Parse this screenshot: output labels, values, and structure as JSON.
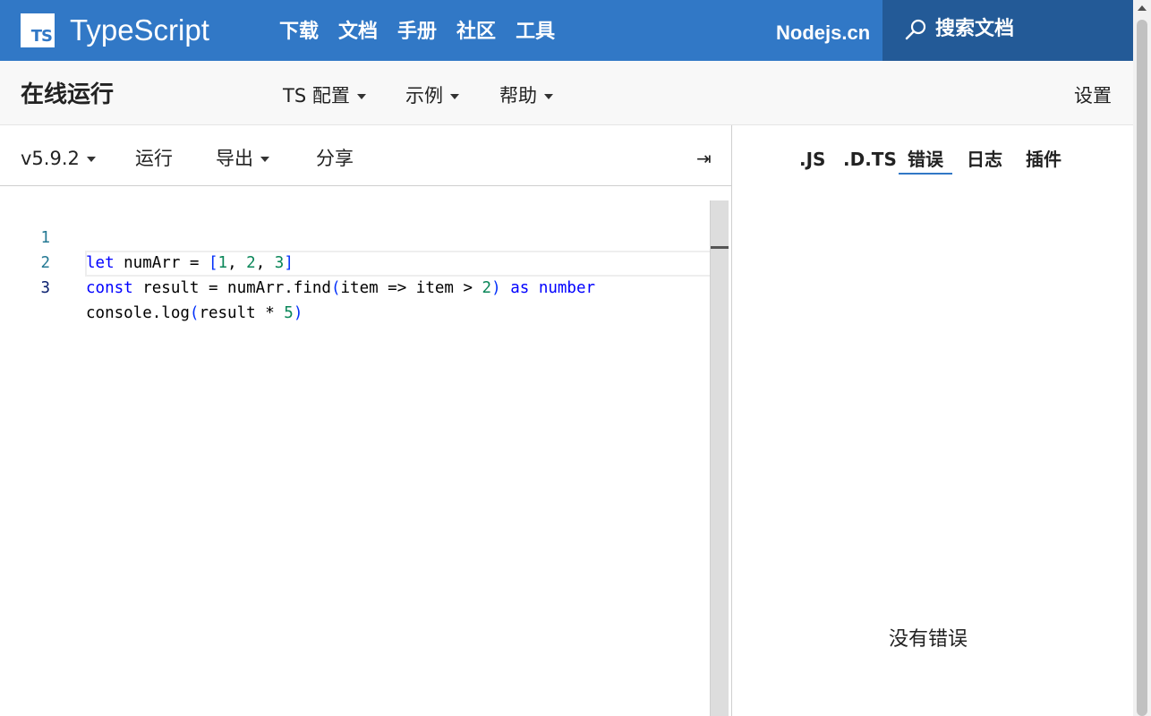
{
  "topnav": {
    "logo_text": "TS",
    "brand": "TypeScript",
    "links": [
      "下载",
      "文档",
      "手册",
      "社区",
      "工具"
    ],
    "nodejs_link": "Nodejs.cn",
    "search_label": "搜索文档",
    "search_icon": "search-icon"
  },
  "subbar": {
    "title": "在线运行",
    "menus": [
      "TS 配置",
      "示例",
      "帮助"
    ],
    "settings": "设置"
  },
  "toolbar": {
    "version": "v5.9.2",
    "run": "运行",
    "export": "导出",
    "share": "分享",
    "collapse_icon": "⇥"
  },
  "editor": {
    "line_numbers": [
      "1",
      "2",
      "3"
    ],
    "active_line": 3,
    "lines": [
      "let numArr = [1, 2, 3]",
      "const result = numArr.find(item => item > 2) as number",
      "console.log(result * 5)"
    ]
  },
  "output": {
    "tabs": [
      ".JS",
      ".D.TS",
      "错误",
      "日志",
      "插件"
    ],
    "active_tab": "错误",
    "message": "没有错误"
  },
  "colors": {
    "brand_blue": "#3178c6",
    "search_bg": "#235a97",
    "keyword": "#0000ff",
    "number": "#098658"
  }
}
